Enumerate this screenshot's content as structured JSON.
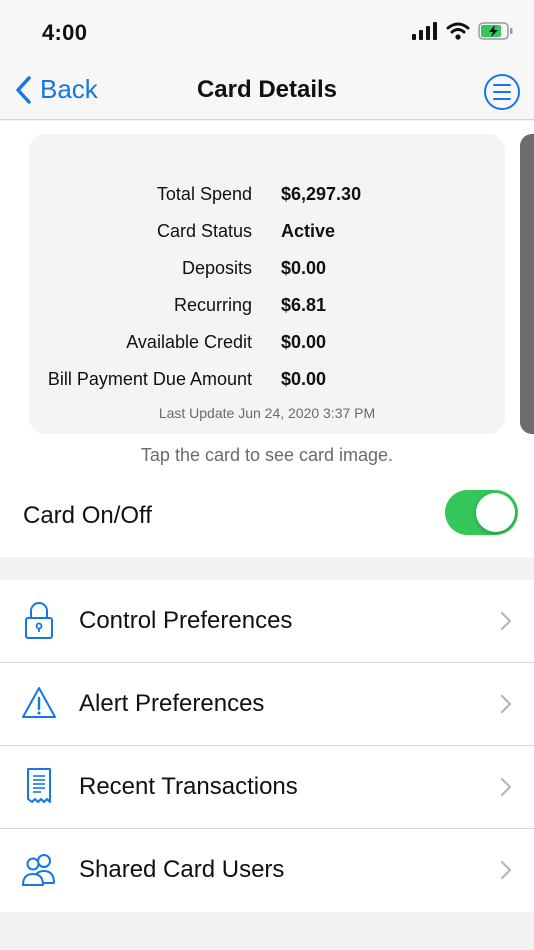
{
  "status_bar": {
    "time": "4:00",
    "icons": [
      "signal-icon",
      "wifi-icon",
      "battery-charging-icon"
    ]
  },
  "nav": {
    "back_label": "Back",
    "title": "Card Details",
    "menu_icon": "menu-icon"
  },
  "card": {
    "rows": [
      {
        "label": "Total Spend",
        "value": "$6,297.30"
      },
      {
        "label": "Card Status",
        "value": "Active"
      },
      {
        "label": "Deposits",
        "value": "$0.00"
      },
      {
        "label": "Recurring",
        "value": "$6.81"
      },
      {
        "label": "Available Credit",
        "value": "$0.00"
      },
      {
        "label": "Bill Payment Due Amount",
        "value": "$0.00"
      }
    ],
    "last_update": "Last Update Jun 24, 2020 3:37 PM",
    "tap_hint": "Tap the card to see card image."
  },
  "card_toggle": {
    "label": "Card On/Off",
    "on": true
  },
  "menu": [
    {
      "label": "Control Preferences",
      "icon": "lock-icon"
    },
    {
      "label": "Alert Preferences",
      "icon": "alert-icon"
    },
    {
      "label": "Recent Transactions",
      "icon": "receipt-icon"
    },
    {
      "label": "Shared Card Users",
      "icon": "users-icon"
    }
  ],
  "colors": {
    "accent": "#1577e6",
    "toggle_on": "#34c759",
    "battery": "#34c759"
  }
}
